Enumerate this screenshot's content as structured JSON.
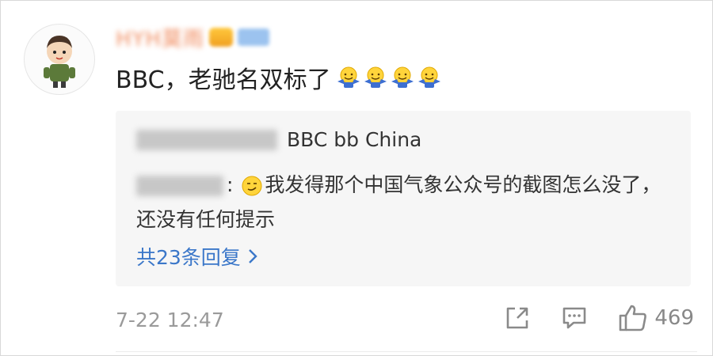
{
  "comment": {
    "username": "HYH莫雨",
    "text": "BBC，老驰名双标了",
    "emoji_icon": "shrug-emoji-icon",
    "emoji_count": 4
  },
  "reply_card": {
    "line1_text": "BBC  bb China",
    "line2_text": "我发得那个中国气象公众号的截图怎么没了，还没有任何提示",
    "more_label": "共23条回复"
  },
  "footer": {
    "timestamp": "7-22 12:47",
    "like_count": "469"
  },
  "colors": {
    "link": "#3b77c9",
    "username": "#f08a5d",
    "muted": "#9a9a9a"
  }
}
